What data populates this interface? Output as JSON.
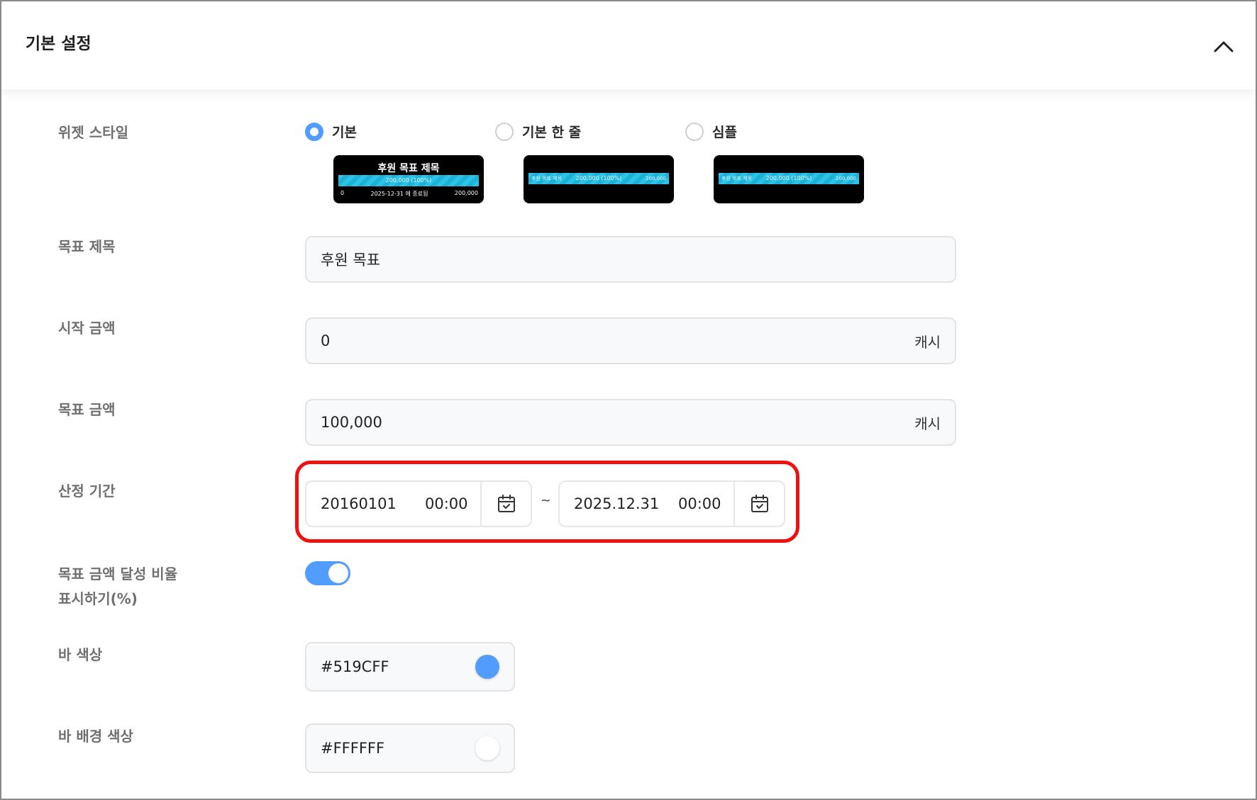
{
  "header": {
    "title": "기본 설정"
  },
  "widget_style": {
    "label": "위젯 스타일",
    "options": [
      {
        "label": "기본",
        "selected": true
      },
      {
        "label": "기본 한 줄",
        "selected": false
      },
      {
        "label": "심플",
        "selected": false
      }
    ],
    "preview": {
      "title": "후원 목표 제목",
      "bar_text": "200,000 (100%)",
      "start": "0",
      "end": "200,000",
      "deadline": "2025-12-31 에 종료됨",
      "line_left": "후원 목표 제목",
      "line_right": "200,000"
    }
  },
  "goal_title": {
    "label": "목표 제목",
    "value": "후원 목표"
  },
  "start_amount": {
    "label": "시작 금액",
    "value": "0",
    "unit": "캐시"
  },
  "goal_amount": {
    "label": "목표 금액",
    "value": "100,000",
    "unit": "캐시"
  },
  "period": {
    "label": "산정 기간",
    "start_date": "20160101",
    "start_time": "00:00",
    "separator": "~",
    "end_date": "2025.12.31",
    "end_time": "00:00"
  },
  "show_ratio": {
    "label_line1": "목표 금액 달성 비율",
    "label_line2": "표시하기(%)",
    "enabled": true
  },
  "bar_color": {
    "label": "바 색상",
    "value": "#519CFF"
  },
  "bar_bg_color": {
    "label": "바 배경 색상",
    "value": "#FFFFFF"
  },
  "colors": {
    "accent": "#519CFF",
    "highlight": "#EE1111"
  },
  "icons": {
    "collapse": "chevron-up-icon",
    "calendar": "calendar-check-icon"
  }
}
